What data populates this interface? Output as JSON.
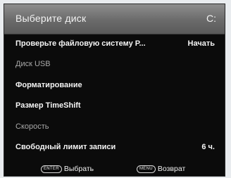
{
  "header": {
    "title": "Выберите диск",
    "drive": "C:"
  },
  "menu": {
    "items": [
      {
        "label": "Проверьте файловую систему Р...",
        "value": "Начать"
      },
      {
        "label": "Диск USB"
      },
      {
        "label": "Форматирование"
      },
      {
        "label": "Размер TimeShift"
      },
      {
        "label": "Скорость"
      },
      {
        "label": "Свободный лимит записи",
        "value": "6 ч."
      }
    ]
  },
  "footer": {
    "enter_key": "ENTER",
    "enter_label": "Выбрать",
    "menu_key": "MENU",
    "menu_label": "Возврат"
  }
}
